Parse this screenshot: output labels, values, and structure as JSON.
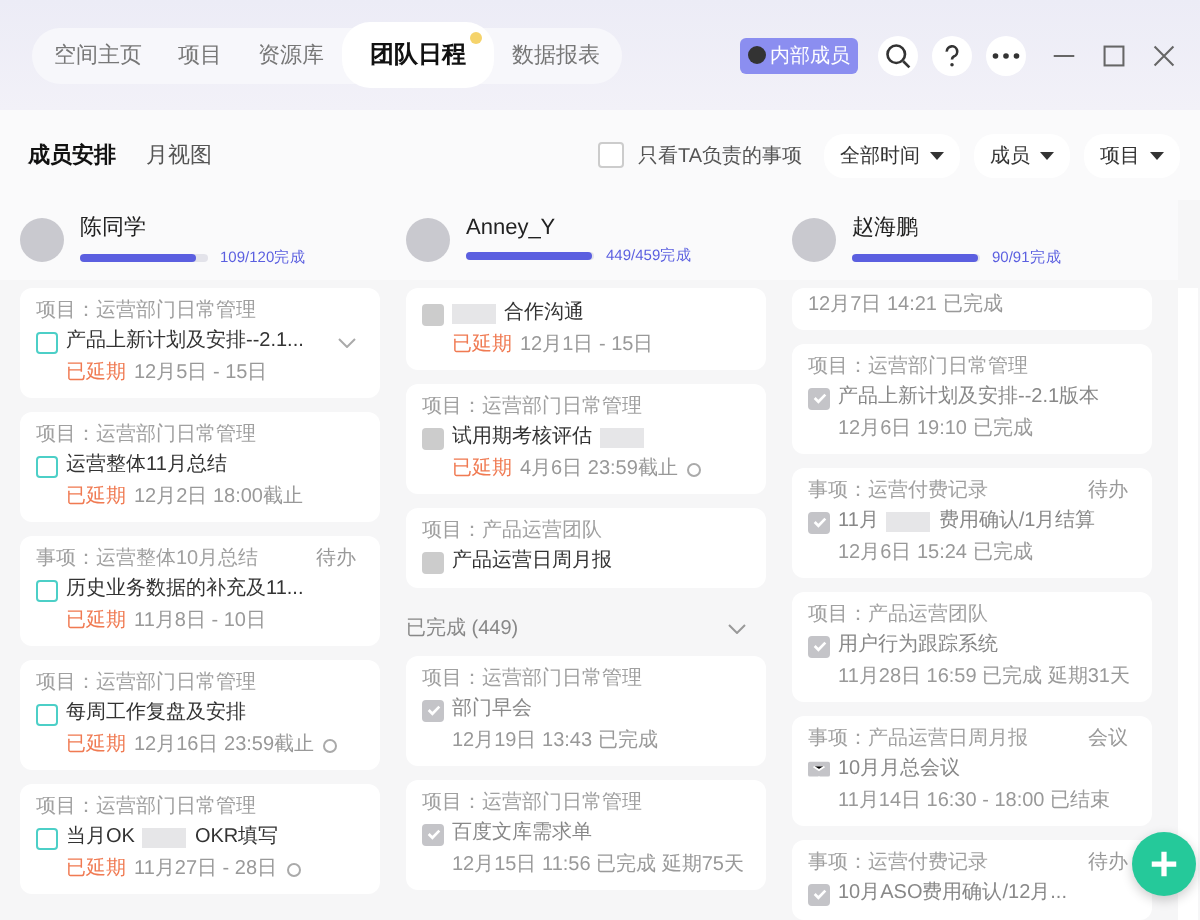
{
  "nav": {
    "tabs": [
      {
        "label": "空间主页",
        "selected": false,
        "dot": false
      },
      {
        "label": "项目",
        "selected": false,
        "dot": false
      },
      {
        "label": "资源库",
        "selected": false,
        "dot": false
      },
      {
        "label": "团队日程",
        "selected": true,
        "dot": true
      },
      {
        "label": "数据报表",
        "selected": false,
        "dot": false
      }
    ],
    "member_badge": "内部成员"
  },
  "views": [
    {
      "label": "成员安排",
      "selected": true
    },
    {
      "label": "月视图",
      "selected": false
    }
  ],
  "filter_checkbox": {
    "label": "只看TA负责的事项",
    "checked": false
  },
  "filters": [
    "全部时间",
    "成员",
    "项目"
  ],
  "members": [
    {
      "name": "陈同学",
      "level": 0.908,
      "reading": "109/120完成",
      "cards": [
        {
          "kind": "todo",
          "checked": false,
          "meta": "项目：运营部门日常管理",
          "title": "产品上新计划及安排--2.1...",
          "overdue": "已延期",
          "date": "12月5日 - 15日",
          "expand": true
        },
        {
          "kind": "todo",
          "checked": false,
          "meta": "项目：运营部门日常管理",
          "title": "运营整体11月总结",
          "overdue": "已延期",
          "date": "12月2日 18:00截止"
        },
        {
          "kind": "todo",
          "checked": false,
          "meta": "事项：运营整体10月总结",
          "title": "历史业务数据的补充及11...",
          "tag": "待办",
          "overdue": "已延期",
          "date": "11月8日 - 10日"
        },
        {
          "kind": "todo",
          "checked": false,
          "meta": "项目：运营部门日常管理",
          "title": "每周工作复盘及安排",
          "overdue": "已延期",
          "date": "12月16日 23:59截止",
          "repeat": true
        },
        {
          "kind": "todo",
          "checked": false,
          "meta": "项目：运营部门日常管理",
          "title": "当月OK",
          "title_blur": true,
          "title_end": "OKR填写",
          "overdue": "已延期",
          "date": "11月27日 - 28日",
          "repeat": true
        }
      ]
    },
    {
      "name": "Anney_Y",
      "level": 0.978,
      "reading": "449/459完成",
      "cards": [
        {
          "kind": "pending",
          "checked": false,
          "title": "合作沟通",
          "title_blur_before": true,
          "overdue": "已延期",
          "date": "12月1日 - 15日"
        },
        {
          "kind": "pending",
          "checked": false,
          "meta": "项目：运营部门日常管理",
          "title": "试用期考核评估",
          "title_blur": true,
          "overdue": "已延期",
          "date": "4月6日 23:59截止",
          "repeat": true
        },
        {
          "kind": "pending",
          "checked": false,
          "meta": "项目：产品运营团队",
          "title": "产品运营日周月报"
        },
        {
          "kind": "section",
          "title": "已完成 (449)"
        },
        {
          "kind": "done",
          "checked": true,
          "meta": "项目：运营部门日常管理",
          "title": "部门早会",
          "date": "12月19日 13:43 已完成"
        },
        {
          "kind": "done",
          "checked": true,
          "meta": "项目：运营部门日常管理",
          "title": "百度文库需求单",
          "date": "12月15日 11:56 已完成 延期75天"
        }
      ]
    },
    {
      "name": "赵海鹏",
      "level": 0.989,
      "reading": "90/91完成",
      "cards": [
        {
          "kind": "tail",
          "date": "12月7日 14:21 已完成"
        },
        {
          "kind": "done",
          "checked": true,
          "meta": "项目：运营部门日常管理",
          "title": "产品上新计划及安排--2.1版本",
          "date": "12月6日 19:10 已完成"
        },
        {
          "kind": "done",
          "checked": true,
          "meta": "事项：运营付费记录",
          "title": "11月",
          "title_blur": true,
          "title_end": "费用确认/1月结算",
          "tag": "待办",
          "date": "12月6日 15:24 已完成"
        },
        {
          "kind": "done",
          "checked": true,
          "meta": "项目：产品运营团队",
          "title": "用户行为跟踪系统",
          "date": "11月28日 16:59 已完成 延期31天"
        },
        {
          "kind": "meeting",
          "meta": "事项：产品运营日周月报",
          "title": "10月月总会议",
          "tag": "会议",
          "date": "11月14日 16:30 - 18:00 已结束"
        },
        {
          "kind": "done",
          "checked": true,
          "meta": "事项：运营付费记录",
          "title": "10月ASO费用确认/12月...",
          "tag": "待办"
        }
      ]
    }
  ]
}
